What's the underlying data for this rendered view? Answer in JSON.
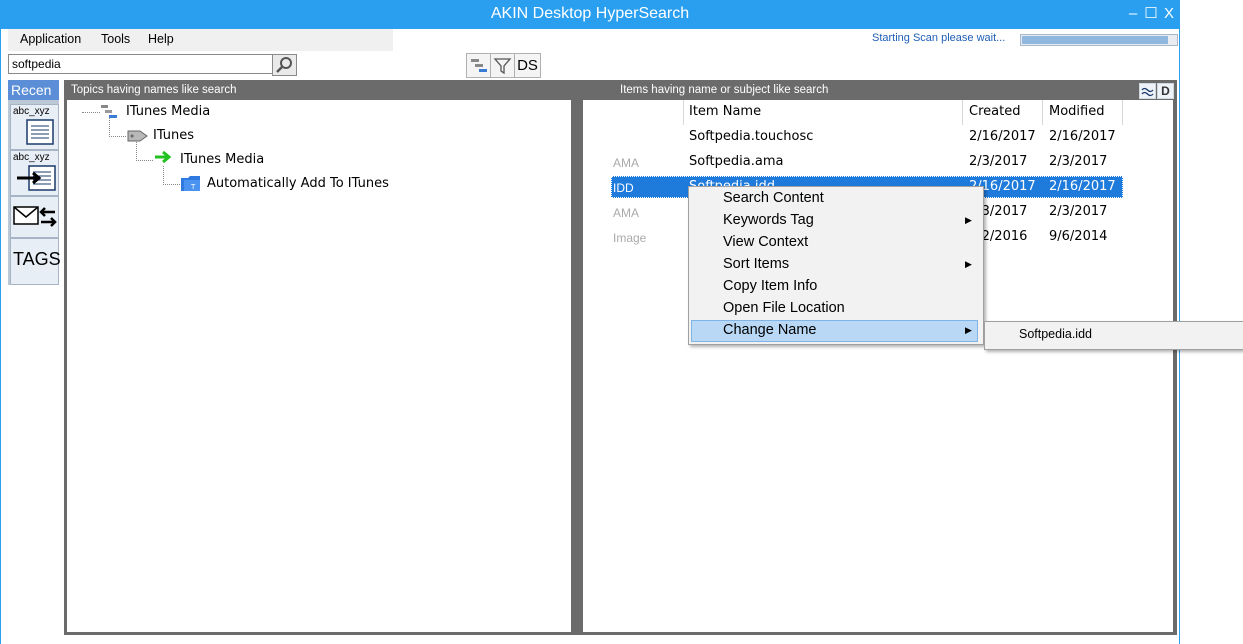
{
  "window": {
    "title": "AKIN Desktop HyperSearch",
    "controls": {
      "minimize": "–",
      "maximize": "☐",
      "close": "X"
    }
  },
  "menu": {
    "items": [
      "Application",
      "Tools",
      "Help"
    ]
  },
  "status": {
    "text": "Starting Scan please wait...",
    "progress": 0.95
  },
  "search": {
    "value": "softpedia"
  },
  "toolbar": {
    "ds_label": "DS"
  },
  "recent": {
    "header": "Recen",
    "tiles": [
      {
        "label": "abc_xyz"
      },
      {
        "label": "abc_xyz"
      },
      {
        "label": ""
      },
      {
        "label": "TAGS"
      }
    ]
  },
  "topics": {
    "header": "Topics having names like search",
    "tree": [
      {
        "label": "ITunes Media",
        "icon": "hierarchy-icon"
      },
      {
        "label": "ITunes",
        "icon": "tag-icon"
      },
      {
        "label": "ITunes Media",
        "icon": "green-arrow-icon"
      },
      {
        "label": "Automatically Add To ITunes",
        "icon": "folder-icon"
      }
    ]
  },
  "items": {
    "header": "Items having name or subject like search",
    "columns": [
      "Item Name",
      "Created",
      "Modified"
    ],
    "rows": [
      {
        "type": "",
        "name": "Softpedia.touchosc",
        "created": "2/16/2017",
        "modified": "2/16/2017"
      },
      {
        "type": "AMA",
        "name": "Softpedia.ama",
        "created": "2/3/2017",
        "modified": "2/3/2017"
      },
      {
        "type": "IDD",
        "name": "Softpedia.idd",
        "created": "2/16/2017",
        "modified": "2/16/2017"
      },
      {
        "type": "AMA",
        "name": "",
        "created": "2/3/2017",
        "modified": "2/3/2017"
      },
      {
        "type": "Image",
        "name": "",
        "created": "9/2/2016",
        "modified": "9/6/2014"
      }
    ],
    "selected_row": 2
  },
  "context_menu": {
    "items": [
      {
        "label": "Search Content",
        "submenu": false
      },
      {
        "label": "Keywords Tag",
        "submenu": true
      },
      {
        "label": "View Context",
        "submenu": false
      },
      {
        "label": "Sort Items",
        "submenu": true
      },
      {
        "label": "Copy Item Info",
        "submenu": false
      },
      {
        "label": "Open File Location",
        "submenu": false
      },
      {
        "label": "Change Name",
        "submenu": true
      }
    ],
    "highlighted": "Change Name",
    "submenu_items": [
      "Softpedia.idd"
    ],
    "arrow_glyph": "▶"
  },
  "colors": {
    "titlebar": "#2a9ff0",
    "selection": "#1e7adb",
    "menu_highlight": "#b8d8f6",
    "frame": "#6b6b6b"
  }
}
